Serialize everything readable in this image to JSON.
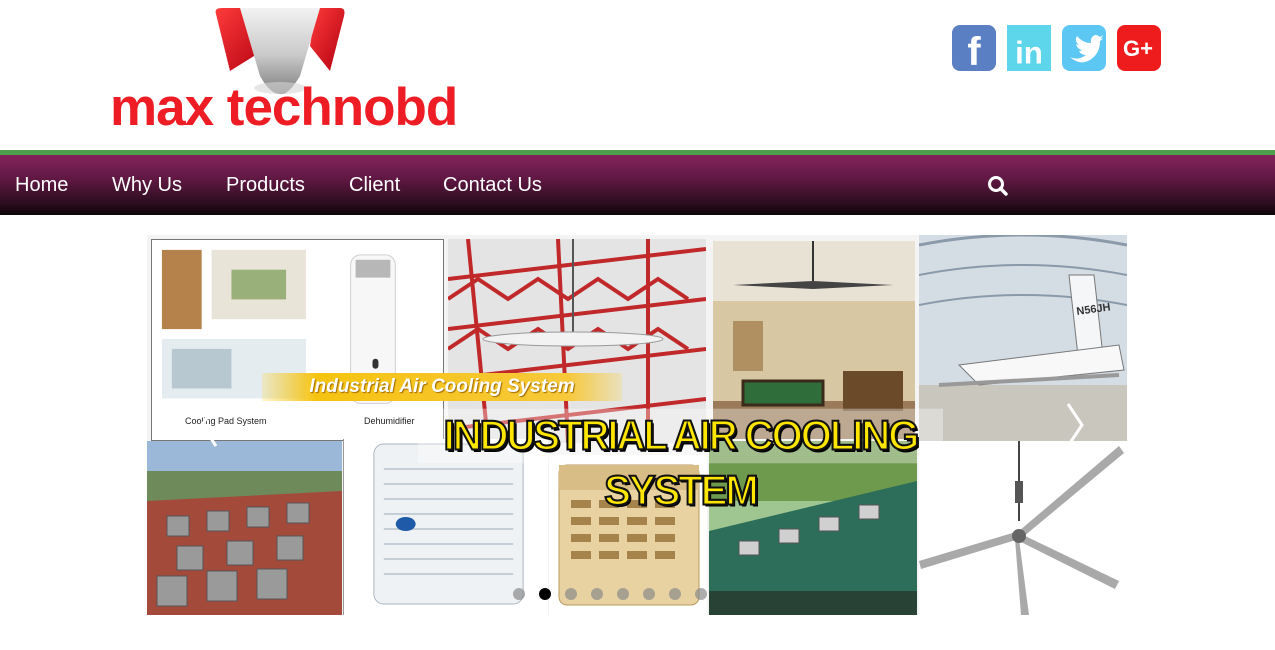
{
  "brand": {
    "name": "max technobd",
    "colors": {
      "red": "#ee1c24",
      "green": "#4fa04a",
      "nav_top": "#84235d",
      "nav_bottom": "#0d0508"
    }
  },
  "social": [
    {
      "name": "facebook-icon",
      "glyph": "f"
    },
    {
      "name": "linkedin-icon",
      "glyph": "in"
    },
    {
      "name": "twitter-icon",
      "glyph": "bird"
    },
    {
      "name": "google-plus-icon",
      "glyph": "G+"
    }
  ],
  "nav": {
    "items": [
      {
        "label": "Home"
      },
      {
        "label": "Why Us"
      },
      {
        "label": "Products"
      },
      {
        "label": "Client"
      },
      {
        "label": "Contact Us"
      }
    ],
    "search_icon": "search-icon"
  },
  "slider": {
    "banner_small": "Industrial Air Cooling System",
    "banner_big": "INDUSTRIAL AIR COOLING SYSTEM",
    "collage_labels": [
      "Cooling Pad System",
      "Dehumidifier"
    ],
    "plane_tail": "N56JH",
    "dots_total": 8,
    "active_dot": 2
  }
}
